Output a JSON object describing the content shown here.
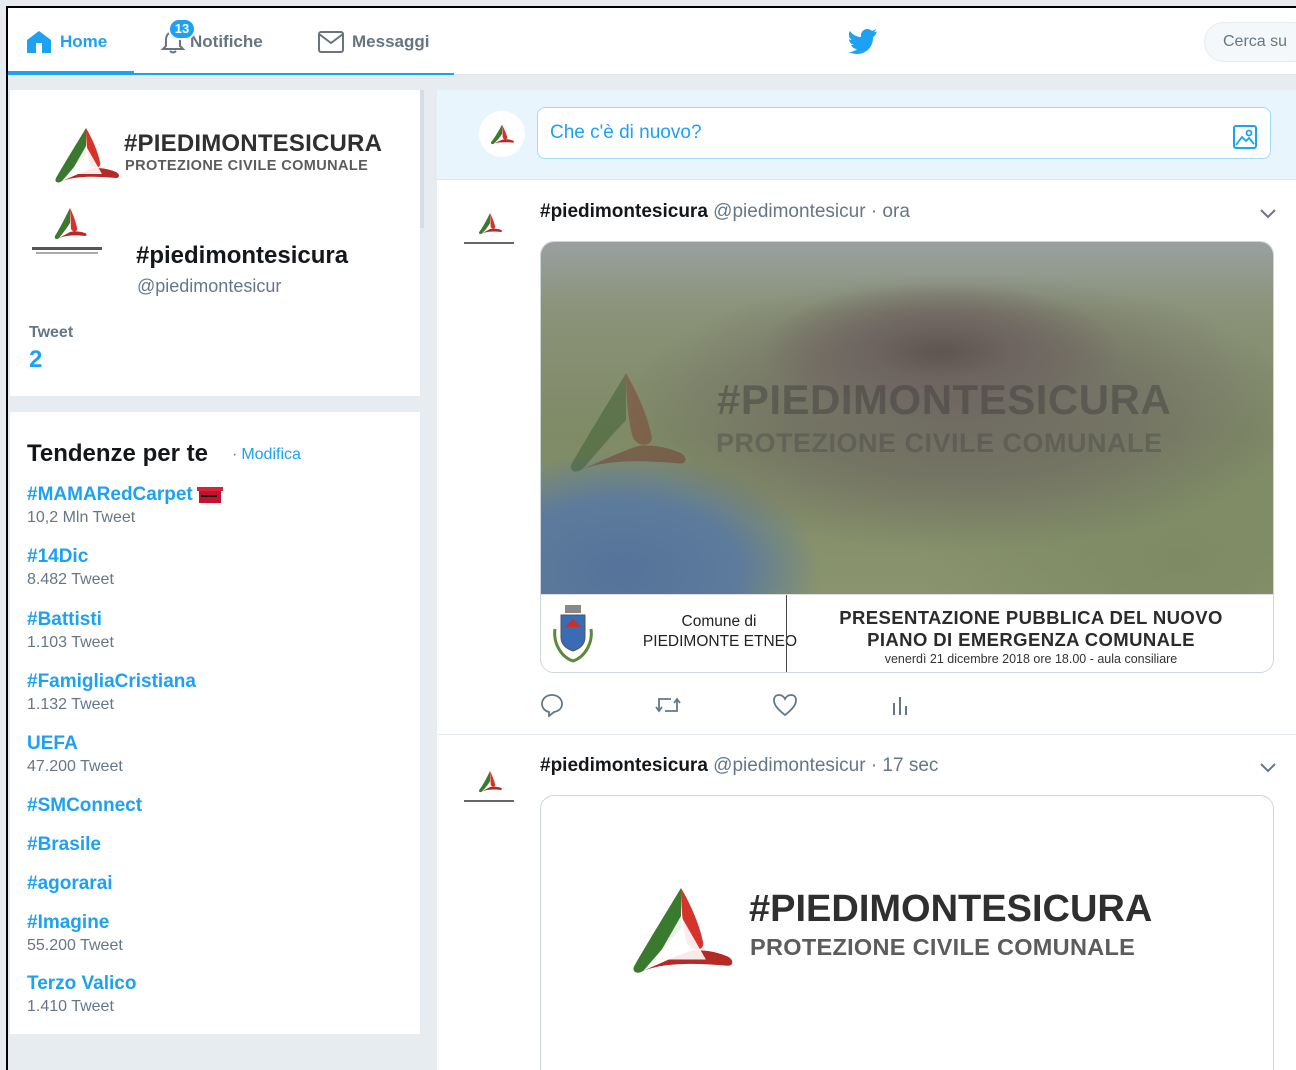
{
  "nav": {
    "home": "Home",
    "notifications": "Notifiche",
    "notifications_badge": "13",
    "messages": "Messaggi",
    "search_placeholder": "Cerca su"
  },
  "profile": {
    "banner_title": "#PIEDIMONTESICURA",
    "banner_subtitle": "PROTEZIONE CIVILE COMUNALE",
    "name": "#piedimontesicura",
    "handle": "@piedimontesicur",
    "stat_label": "Tweet",
    "stat_value": "2"
  },
  "trends": {
    "title": "Tendenze per te",
    "edit": "Modifica",
    "items": [
      {
        "name": "#MAMARedCarpet",
        "count": "10,2 Mln Tweet"
      },
      {
        "name": "#14Dic",
        "count": "8.482 Tweet"
      },
      {
        "name": "#Battisti",
        "count": "1.103 Tweet"
      },
      {
        "name": "#FamigliaCristiana",
        "count": "1.132 Tweet"
      },
      {
        "name": "UEFA",
        "count": "47.200 Tweet"
      },
      {
        "name": "#SMConnect",
        "count": ""
      },
      {
        "name": "#Brasile",
        "count": ""
      },
      {
        "name": "#agorarai",
        "count": ""
      },
      {
        "name": "#Imagine",
        "count": "55.200 Tweet"
      },
      {
        "name": "Terzo Valico",
        "count": "1.410 Tweet"
      }
    ]
  },
  "composer": {
    "placeholder": "Che c'è di nuovo?"
  },
  "tweets": [
    {
      "name": "#piedimontesicura",
      "handle": "@piedimontesicur",
      "time": "ora",
      "image": {
        "title": "#PIEDIMONTESICURA",
        "subtitle": "PROTEZIONE CIVILE COMUNALE",
        "comune_line1": "Comune di",
        "comune_line2": "PIEDIMONTE ETNEO",
        "headline1": "PRESENTAZIONE PUBBLICA DEL NUOVO",
        "headline2": "PIANO DI EMERGENZA COMUNALE",
        "details": "venerdì 21 dicembre 2018 ore 18.00 - aula consiliare"
      }
    },
    {
      "name": "#piedimontesicura",
      "handle": "@piedimontesicur",
      "time": "17 sec",
      "image": {
        "title": "#PIEDIMONTESICURA",
        "subtitle": "PROTEZIONE CIVILE COMUNALE"
      }
    }
  ],
  "colors": {
    "accent": "#1da1f2",
    "text": "#14171a",
    "muted": "#657786",
    "background": "#e6ecf0"
  }
}
